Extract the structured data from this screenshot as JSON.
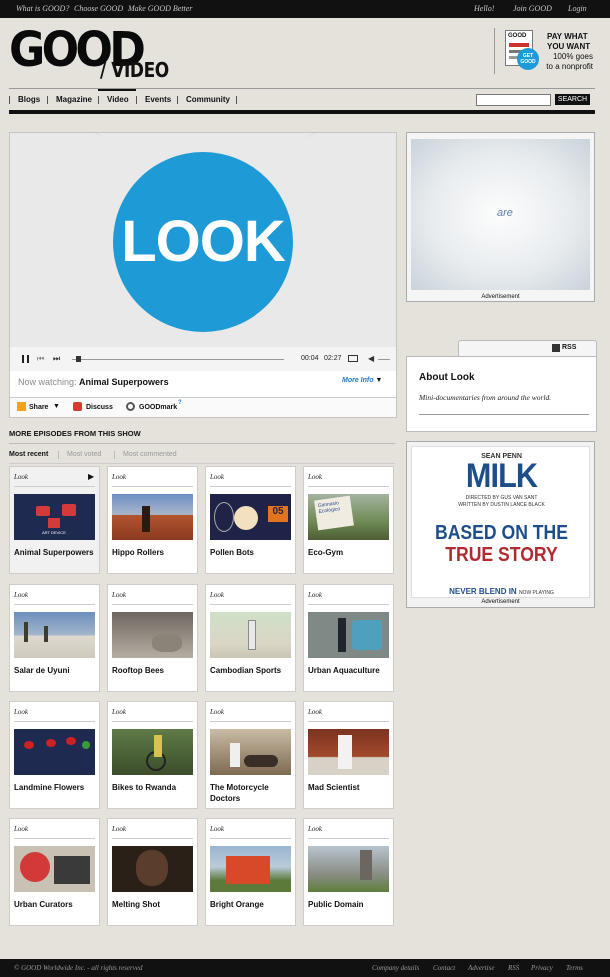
{
  "topbar": {
    "left_links": [
      "What is GOOD?",
      "Choose GOOD",
      "Make GOOD Better"
    ],
    "right_links": [
      "Hello!",
      "Join GOOD",
      "Login"
    ]
  },
  "header": {
    "logo": "GOOD",
    "section": "/ VIDEO",
    "promo": {
      "line1": "PAY WHAT",
      "line2": "YOU WANT",
      "line3": "100% goes",
      "line4": "to a nonprofit",
      "badge": "GET GOOD",
      "magazine_mark": "GOOD"
    }
  },
  "nav": {
    "items": [
      "Blogs",
      "Magazine",
      "Video",
      "Events",
      "Community"
    ],
    "active": "Video",
    "search_button": "SEARCH",
    "search_value": ""
  },
  "player": {
    "video_text": "LOOK",
    "time_elapsed": "00:04",
    "time_total": "02:27",
    "progress_fraction": 0.03,
    "now_watching_label": "Now watching:",
    "now_watching_title": "Animal Superpowers",
    "more_info": "More Info",
    "actions": [
      "Share",
      "Discuss",
      "GOODmark"
    ],
    "goodmark_help": "?"
  },
  "sidebar": {
    "ad1_text": "are",
    "ad_label": "Advertisement",
    "about": {
      "rss": "RSS",
      "title": "About Look",
      "description": "Mini-documentaries from around the world."
    },
    "ad2": {
      "star": "SEAN PENN",
      "title": "MILK",
      "credits1": "DIRECTED BY GUS VAN SANT",
      "credits2": "WRITTEN BY DUSTIN LANCE BLACK",
      "tag1": "BASED ON THE",
      "tag2": "TRUE STORY",
      "tag3": "NEVER BLEND IN",
      "tag4": "NOW PLAYING"
    }
  },
  "episodes": {
    "title": "MORE EPISODES FROM THIS SHOW",
    "filters": [
      "Most recent",
      "Most voted",
      "Most commented"
    ],
    "selected_filter": "Most recent",
    "show": "Look",
    "items": [
      {
        "title": "Animal Superpowers",
        "thumb": "animal-superpowers"
      },
      {
        "title": "Hippo Rollers",
        "thumb": "hippo-rollers"
      },
      {
        "title": "Pollen Bots",
        "thumb": "pollen-bots"
      },
      {
        "title": "Eco-Gym",
        "thumb": "eco-gym"
      },
      {
        "title": "Salar de Uyuni",
        "thumb": "salar-de-uyuni"
      },
      {
        "title": "Rooftop Bees",
        "thumb": "rooftop-bees"
      },
      {
        "title": "Cambodian Sports",
        "thumb": "cambodian-sports"
      },
      {
        "title": "Urban Aquaculture",
        "thumb": "urban-aquaculture"
      },
      {
        "title": "Landmine Flowers",
        "thumb": "landmine-flowers"
      },
      {
        "title": "Bikes to Rwanda",
        "thumb": "bikes-to-rwanda"
      },
      {
        "title": "The Motorcycle Doctors",
        "thumb": "motorcycle-doctors"
      },
      {
        "title": "Mad Scientist",
        "thumb": "mad-scientist"
      },
      {
        "title": "Urban Curators",
        "thumb": "urban-curators"
      },
      {
        "title": "Melting Shot",
        "thumb": "melting-shot"
      },
      {
        "title": "Bright Orange",
        "thumb": "bright-orange"
      },
      {
        "title": "Public Domain",
        "thumb": "public-domain"
      }
    ],
    "thumb_text": {
      "pollen_number": "05",
      "eco_sign": "Gimnasio Ecológico",
      "art_device": "ART DEVICE"
    }
  },
  "footer": {
    "copyright": "© GOOD Worldwide Inc. - all rights reserved",
    "links": [
      "Company details",
      "Contact",
      "Advertise",
      "RSS",
      "Privacy",
      "Terms"
    ]
  },
  "colors": {
    "accent_blue": "#1e9bd7",
    "dark": "#111111",
    "link_blue": "#1b7bd0"
  }
}
